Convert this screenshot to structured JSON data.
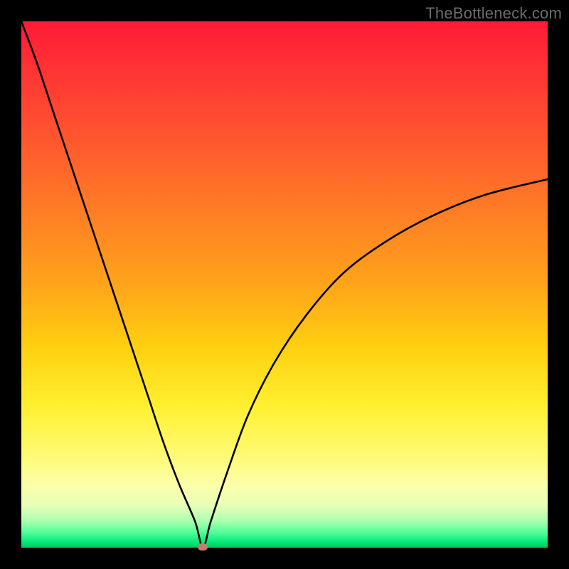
{
  "watermark": "TheBottleneck.com",
  "chart_data": {
    "type": "line",
    "title": "",
    "xlabel": "",
    "ylabel": "",
    "xlim": [
      0,
      100
    ],
    "ylim": [
      0,
      100
    ],
    "grid": false,
    "legend": false,
    "background_gradient": {
      "orientation": "vertical",
      "stops": [
        {
          "pos": 0,
          "color": "#ff1a36",
          "meaning": "worst"
        },
        {
          "pos": 50,
          "color": "#ffb41a"
        },
        {
          "pos": 85,
          "color": "#fff566"
        },
        {
          "pos": 100,
          "color": "#00d060",
          "meaning": "best"
        }
      ]
    },
    "series": [
      {
        "name": "bottleneck-curve",
        "x": [
          0,
          3,
          6,
          9,
          12,
          15,
          18,
          21,
          24,
          27,
          30,
          33,
          34.5,
          36,
          39,
          43,
          48,
          54,
          61,
          69,
          78,
          88,
          100
        ],
        "values": [
          100,
          92,
          83,
          74,
          65,
          56,
          47,
          38,
          29,
          20,
          12,
          5,
          0,
          5,
          14,
          25,
          35,
          44,
          52,
          58,
          63,
          67,
          70
        ],
        "color": "#000000"
      }
    ],
    "marker": {
      "name": "optimum-point",
      "x": 34.5,
      "y": 0,
      "color": "#c97a6f"
    }
  }
}
